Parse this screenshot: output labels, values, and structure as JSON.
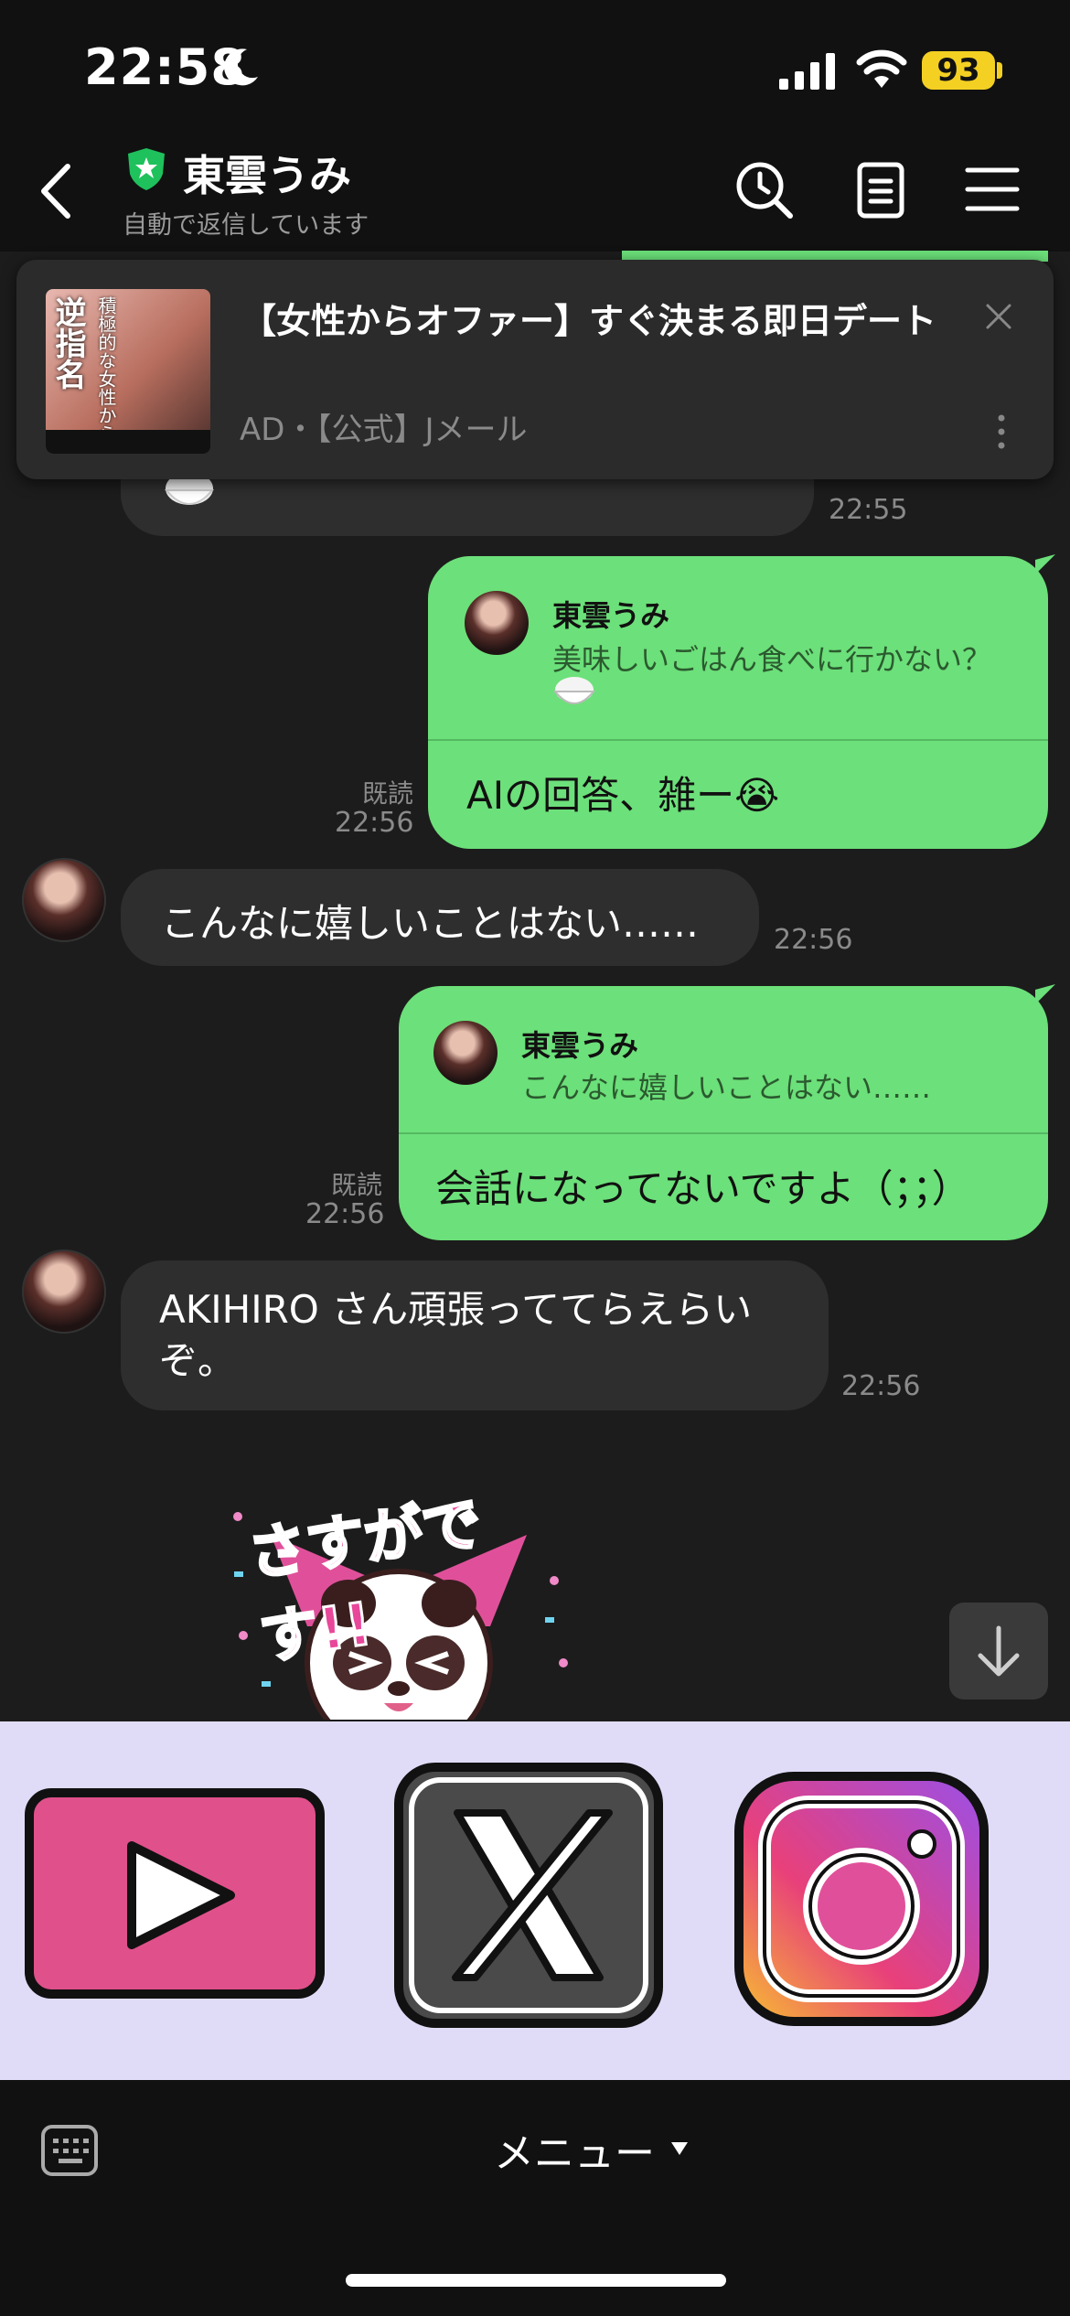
{
  "status": {
    "time": "22:58",
    "battery": "93"
  },
  "header": {
    "name": "東雲うみ",
    "subtitle": "自動で返信しています"
  },
  "ad": {
    "title": "【女性からオファー】すぐ決まる即日デート",
    "meta": "AD・【公式】Jメール",
    "thumb_text": "逆指名",
    "thumb_text2": "積極的な女性から"
  },
  "messages": {
    "m1_time": "22:55",
    "m2": {
      "read": "既読",
      "time": "22:56",
      "reply_name": "東雲うみ",
      "reply_quote": "美味しいごはん食べに行かない？",
      "text": "AIの回答、雑ー😭"
    },
    "m3": {
      "text": "こんなに嬉しいことはない……",
      "time": "22:56"
    },
    "m4": {
      "read": "既読",
      "time": "22:56",
      "reply_name": "東雲うみ",
      "reply_quote": "こんなに嬉しいことはない……",
      "text": "会話になってないですよ（；；）"
    },
    "m5": {
      "text": "AKIHIRO さん頑張っててらえらいぞ。",
      "time": "22:56"
    },
    "sticker_text": "さすがです!!"
  },
  "rich_menu": {
    "items": [
      "YouTube",
      "X",
      "Instagram"
    ]
  },
  "bottom": {
    "menu_label": "メニュー"
  },
  "colors": {
    "green_bubble": "#6ce07a",
    "dark_bubble": "#2e2e2e",
    "rich_menu_bg": "#e0dcf8"
  }
}
